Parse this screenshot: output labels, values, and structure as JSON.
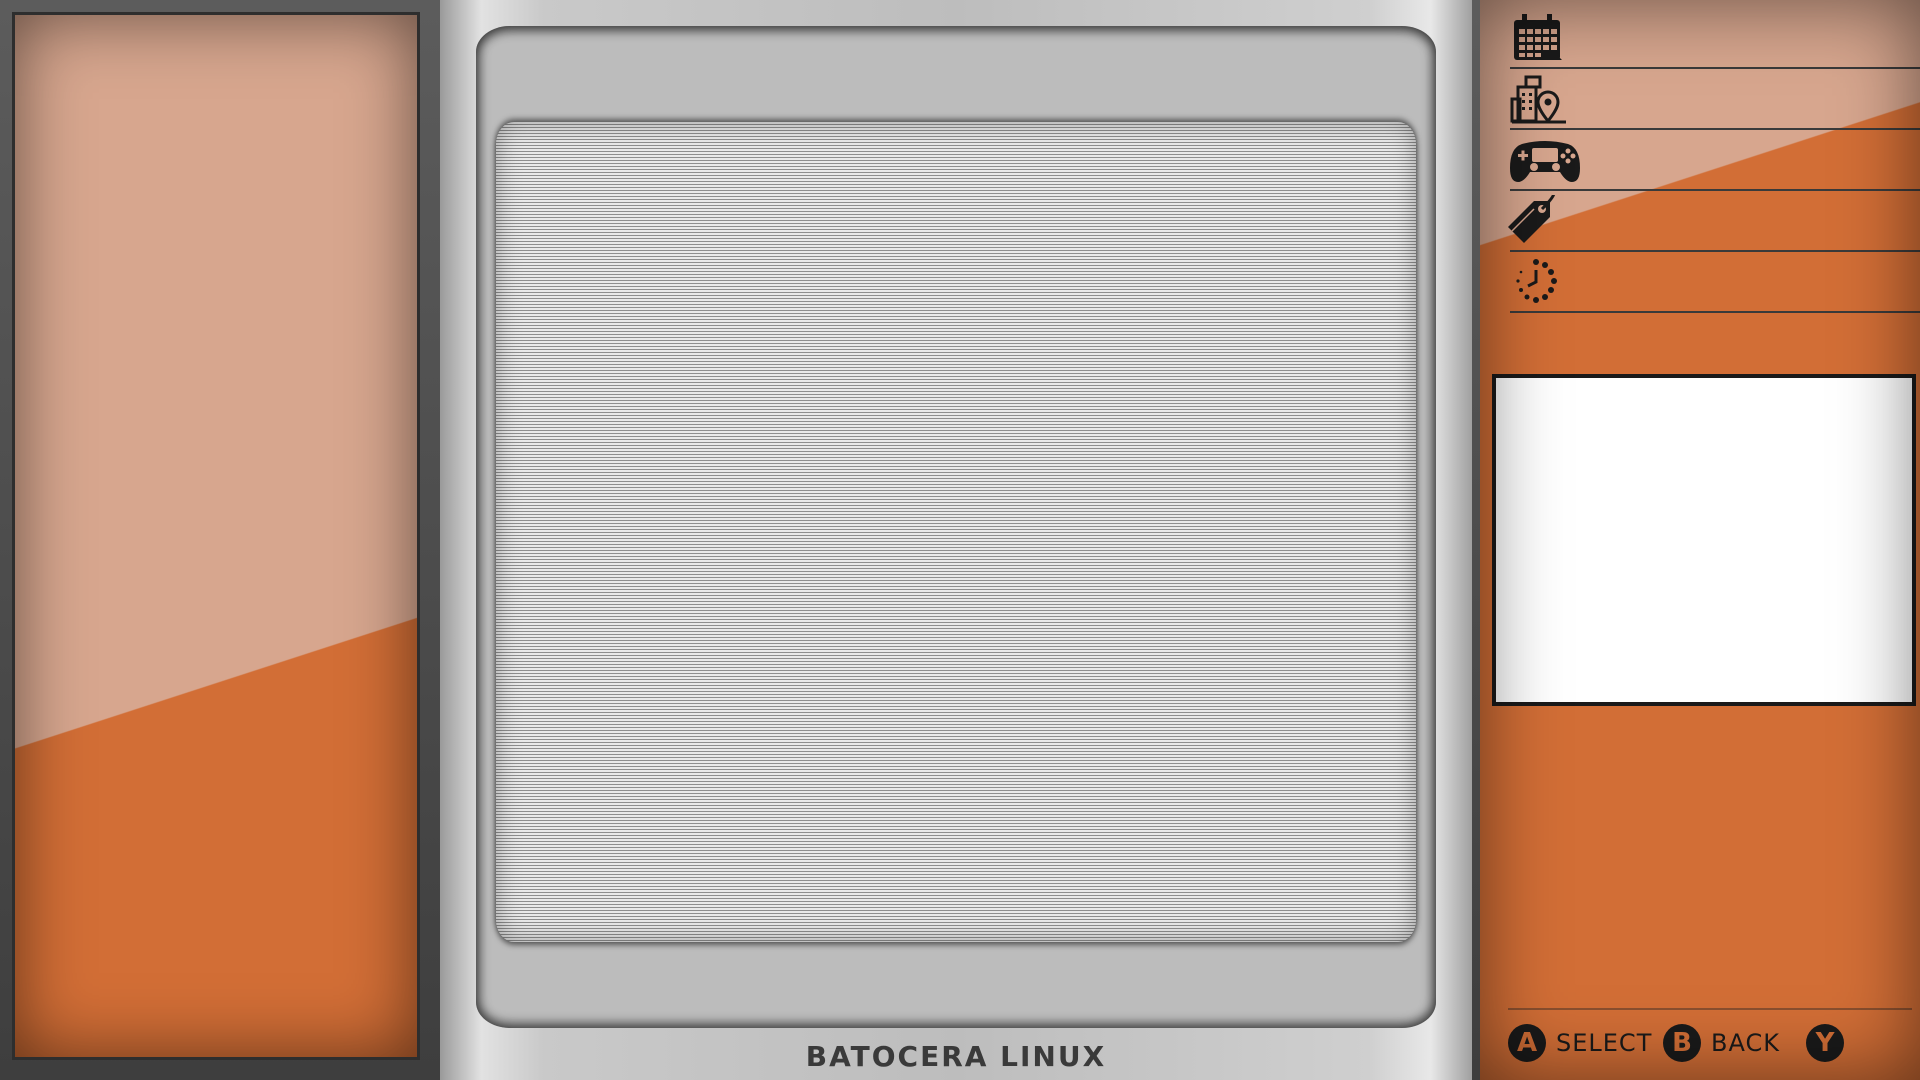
{
  "tv": {
    "label": "BATOCERA LINUX"
  },
  "metadata": {
    "fields": [
      {
        "icon": "calendar-icon",
        "value": ""
      },
      {
        "icon": "developer-location-icon",
        "value": ""
      },
      {
        "icon": "gamepad-icon",
        "value": ""
      },
      {
        "icon": "genre-tag-icon",
        "value": ""
      },
      {
        "icon": "last-played-clock-icon",
        "value": ""
      }
    ]
  },
  "help": {
    "a": {
      "button": "A",
      "label": "SELECT"
    },
    "b": {
      "button": "B",
      "label": "BACK"
    },
    "y": {
      "button": "Y",
      "label": ""
    }
  },
  "colors": {
    "accent_orange": "#d26e36",
    "panel_peach": "#d7a68e",
    "bezel_gray": "#bcbcbc",
    "icon_dark": "#1a1a1a"
  }
}
